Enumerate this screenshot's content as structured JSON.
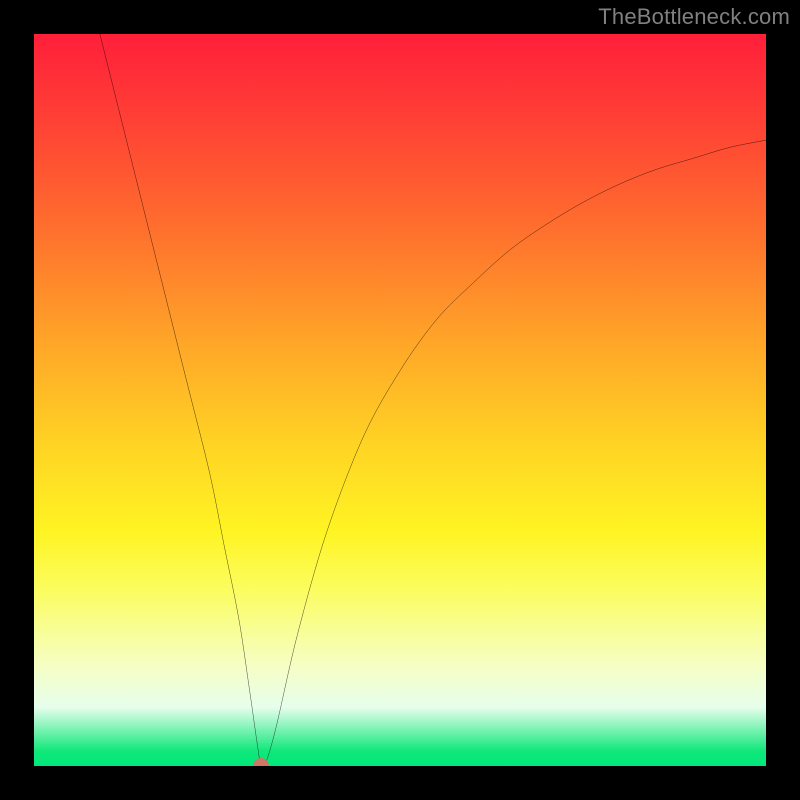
{
  "attribution": "TheBottleneck.com",
  "colors": {
    "background": "#000000",
    "gradient_top": "#ff1f3a",
    "gradient_bottom": "#00e87a",
    "curve_stroke": "#000000",
    "dot_fill": "#cd7867",
    "attribution_text": "#808080"
  },
  "chart_data": {
    "type": "line",
    "title": "",
    "xlabel": "",
    "ylabel": "",
    "xlim": [
      0,
      100
    ],
    "ylim": [
      0,
      100
    ],
    "x": [
      9,
      12,
      15,
      18,
      21,
      24,
      26,
      28,
      29.5,
      30.5,
      31,
      31.5,
      33,
      36,
      40,
      45,
      50,
      55,
      60,
      65,
      70,
      75,
      80,
      85,
      90,
      95,
      100
    ],
    "y": [
      100,
      88,
      76,
      64,
      52,
      40,
      30,
      20,
      10,
      3,
      0,
      0,
      5,
      18,
      32,
      45,
      54,
      61,
      66,
      70.5,
      74,
      77,
      79.5,
      81.5,
      83,
      84.5,
      85.5
    ],
    "minimum_point": {
      "x": 31,
      "y": 0
    },
    "annotations": []
  }
}
